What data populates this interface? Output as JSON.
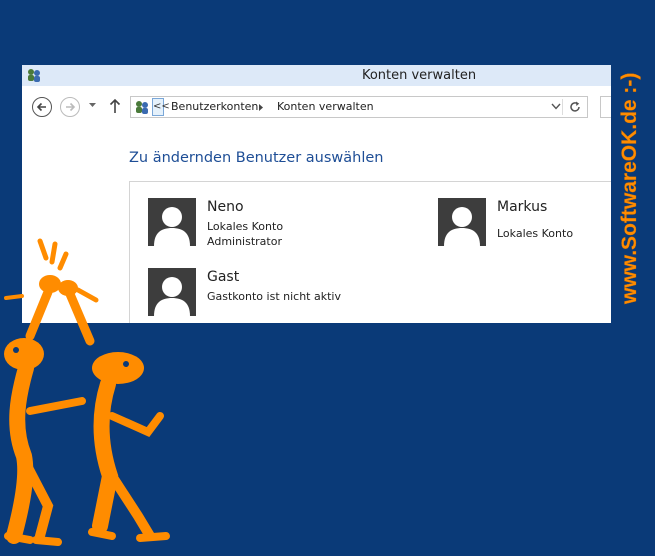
{
  "window": {
    "title": "Konten verwalten"
  },
  "address_bar": {
    "more_label": "<<",
    "crumbs": [
      "Benutzerkonten",
      "Konten verwalten"
    ]
  },
  "main": {
    "heading": "Zu ändernden Benutzer auswählen",
    "accounts": [
      {
        "name": "Neno",
        "lines": [
          "Lokales Konto",
          "Administrator"
        ]
      },
      {
        "name": "Markus",
        "lines": [
          "Lokales Konto"
        ]
      },
      {
        "name": "Gast",
        "lines": [
          "Gastkonto ist nicht aktiv"
        ]
      }
    ]
  },
  "watermark": {
    "text": "www.SoftwareOK.de :-)"
  },
  "colors": {
    "desktop": "#0a3a78",
    "titlebar": "#dde9f8",
    "heading": "#1e4e96",
    "avatar": "#3d3d3d",
    "watermark": "#ff8c00"
  },
  "icons": [
    "app-icon",
    "back-arrow-icon",
    "forward-arrow-icon",
    "chevron-down-icon",
    "up-arrow-icon",
    "users-icon",
    "chevron-right-icon",
    "refresh-icon",
    "user-silhouette-icon"
  ]
}
